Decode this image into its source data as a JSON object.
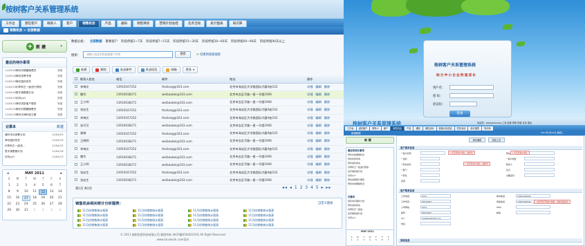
{
  "app": {
    "title": "桉树客户关系管理系统"
  },
  "toplinks": [
    "欢迎您：wangxuesong",
    "工具",
    "设置",
    "帮助",
    "风格",
    "支持",
    "帮助",
    "退出"
  ],
  "nav": {
    "tabs": [
      "工作台",
      "潜在客户",
      "联系人",
      "客户",
      "销售机会",
      "产品",
      "通知",
      "销售目标",
      "营销计划总结",
      "任务活动",
      "统计图表",
      "知识库"
    ]
  },
  "breadcrumb": "销售机会 > 全部数据",
  "datetext": "2011年4月20日 (农历4月初四) 星期三",
  "new_button": {
    "label": "新 建"
  },
  "tasks": {
    "title": "最近的待办事项",
    "items": [
      {
        "date": "11/05/25",
        "text": "拜访刘德耀销售员",
        "status": "完成"
      },
      {
        "date": "11/05/18",
        "text": "拜访张哥专场",
        "status": "完成"
      },
      {
        "date": "11/05/19",
        "text": "拜访蓝科张先",
        "status": "完成"
      },
      {
        "date": "11/04/15",
        "text": "约李科王一起进行预测",
        "status": "完成"
      },
      {
        "date": "11/04/16",
        "text": "签字销售额计划",
        "status": "完成"
      },
      {
        "date": "11/04/13",
        "text": "访问py1",
        "status": "完成"
      },
      {
        "date": "11/04/12",
        "text": "拜访资部客户服务",
        "status": "完成"
      },
      {
        "date": "11/05/10",
        "text": "拜访刘德耀销售员",
        "status": "完成"
      },
      {
        "date": "11/04/15",
        "text": "拜访天津科技王曼",
        "status": "完成"
      }
    ]
  },
  "notes": {
    "title": "记事本",
    "more": "新建",
    "items": [
      {
        "text": "通写本月销售计划",
        "date": "11/04/25"
      },
      {
        "text": "拜访蓝科张先",
        "date": "11/04/19"
      },
      {
        "text": "约李科王一起进...",
        "date": "11/04/15"
      },
      {
        "text": "签字销售额计划",
        "date": "11/04/16"
      },
      {
        "text": "访问py1",
        "date": "11/04/13"
      }
    ]
  },
  "calendar": {
    "month": "MAY 2011",
    "weekdays": [
      "S",
      "M",
      "T",
      "W",
      "T",
      "F",
      "S"
    ],
    "days": [
      "1",
      "2",
      "3",
      "4",
      "5",
      "6",
      "7",
      "8",
      "9",
      "10",
      "11",
      "12",
      "13",
      "14",
      "15",
      "16",
      "17",
      "18",
      "19",
      "20",
      "21",
      "22",
      "23",
      "24",
      "25",
      "26",
      "27",
      "28",
      "29",
      "30",
      "31",
      "1",
      "2",
      "3",
      "4"
    ]
  },
  "filter": {
    "label": "数据分类：",
    "items": [
      "全部数据",
      "重要客户",
      "阶段停留2~7天",
      "阶段停留7~15天",
      "阶段停留15~30天",
      "阶段停留30~60天",
      "阶段停留60~90天",
      "阶段停留90天以上"
    ]
  },
  "search": {
    "label": "搜索：",
    "placeholder": "请输入机会名称或者客户名称",
    "button": "搜索",
    "advanced": "切换到高级搜索"
  },
  "toolbar": [
    "新建",
    "删除",
    "发送邮件",
    "发送短信",
    "邮箱",
    "更多"
  ],
  "table": {
    "headers": [
      "",
      "联系人姓名",
      "电话",
      "邮件",
      "地址",
      "操作"
    ],
    "rows": [
      {
        "name": "李梅文",
        "phone": "13910167252",
        "email": "thailong@163.com",
        "addr": "北京市海淀区大学路国际大厦A座102",
        "ops": [
          "详细",
          "编辑",
          "删除"
        ]
      },
      {
        "name": "魏华",
        "phone": "13910038271",
        "email": "weibaobei@163.com",
        "addr": "北京市台区华路一星一号楼1906",
        "ops": [
          "详细",
          "编辑",
          "删除"
        ]
      },
      {
        "name": "王小明",
        "phone": "13910038271",
        "email": "weibaobei@163.com",
        "addr": "北京市台区华路一星一号楼1906",
        "ops": [
          "详细",
          "编辑",
          "删除"
        ]
      },
      {
        "name": "张宏生",
        "phone": "13910167252",
        "email": "thailong@163.com",
        "addr": "北京市海淀区大学路国际大厦A座102",
        "ops": [
          "详细",
          "编辑",
          "删除"
        ]
      },
      {
        "name": "李梅文",
        "phone": "13910167252",
        "email": "thailong@163.com",
        "addr": "北京市海淀区大学路国际大厦A座102",
        "ops": [
          "详细",
          "编辑",
          "删除"
        ]
      },
      {
        "name": "张可可",
        "phone": "13910038271",
        "email": "weibaobei@163.com",
        "addr": "北京市台区华路一星一号楼1906",
        "ops": [
          "详细",
          "编辑",
          "删除"
        ]
      },
      {
        "name": "谢晓",
        "phone": "13910167252",
        "email": "thailong@163.com",
        "addr": "北京市海淀区大学路国际大厦A座102",
        "ops": [
          "详细",
          "编辑",
          "删除"
        ]
      },
      {
        "name": "王晓明",
        "phone": "13910038271",
        "email": "weibaobei@163.com",
        "addr": "北京市台区华路一星一号楼1906",
        "ops": [
          "详细",
          "编辑",
          "删除"
        ]
      },
      {
        "name": "李梅文",
        "phone": "13910167252",
        "email": "thailong@163.com",
        "addr": "北京市海淀区大学路国际大厦A座102",
        "ops": [
          "详细",
          "编辑",
          "删除"
        ]
      },
      {
        "name": "魏华",
        "phone": "13910038271",
        "email": "weibaobei@163.com",
        "addr": "北京市台区华路一星一号楼1906",
        "ops": [
          "详细",
          "编辑",
          "删除"
        ]
      },
      {
        "name": "王小明",
        "phone": "13910038271",
        "email": "weibaobei@163.com",
        "addr": "北京市台区华路一星一号楼1906",
        "ops": [
          "详细",
          "编辑",
          "删除"
        ]
      },
      {
        "name": "张宏生",
        "phone": "13910167252",
        "email": "thailong@163.com",
        "addr": "北京市海淀区大学路国际大厦A座102",
        "ops": [
          "详细",
          "编辑",
          "删除"
        ]
      },
      {
        "name": "张宏生",
        "phone": "13910038271",
        "email": "weibaobei@163.com",
        "addr": "北京市台区华路一星一号楼1906",
        "ops": [
          "详细",
          "编辑",
          "删除"
        ]
      }
    ]
  },
  "pager": {
    "info": "第1页 共2页",
    "links": "◂◂ ◂ 1 2 3 4 5 ▸ ▸▸"
  },
  "analysis": {
    "title": "销售机会相关统计分析图表：",
    "more": "自定义图表",
    "reports": [
      "11月份销售统计报表",
      "11月份销售统计报表",
      "11月份销售统计报表",
      "11月份销售统计报表",
      "11月份销售统计报表",
      "11月份销售统计报表",
      "11月份销售统计报表",
      "11月份销售统计报表",
      "11月份销售统计报表",
      "11月份销售统计报表",
      "11月份销售统计报表",
      "11月份销售统计报表",
      "11月份销售统计报表",
      "11月份销售统计报表",
      "11月份销售统计报表",
      "11月份销售统计报表"
    ]
  },
  "footer": {
    "line1": "© 2011 桉树信息科技有限公司 版权所有  京ICP备05002010号 All Right Reserved",
    "line2": "www.tanswork.com设计"
  },
  "login": {
    "title": "桉树客户关系管理系统",
    "slogan": "助力中小企业快速成长",
    "fields": [
      "用户名：",
      "密 码：",
      "验证码："
    ],
    "button": "登录"
  },
  "mini": {
    "title": "桉树客户关系管理系统",
    "links": "欢迎您：wangxuesong  工具  设置  帮助  风格  支持  退出",
    "tabs": [
      "工作台",
      "潜在客户",
      "联系人",
      "客户",
      "销售机会",
      "产品",
      "通知",
      "销售目标",
      "营销计划总结",
      "任务活动",
      "统计图表",
      "知识库"
    ],
    "crumb": "新增数据",
    "date": "2011年4月20日 星期三",
    "new": "新 建",
    "tasks_title": "最近的待办事项",
    "tasks": [
      "拜访刘德耀销售员",
      "拜访张哥专场",
      "拜访蓝科张先",
      "约李科王一起进行预测",
      "签字销售额计划",
      "访问py1",
      "拜访资部客户服务",
      "拜访刘德耀销售员"
    ],
    "notes_title": "记事本",
    "notes": [
      "通写本月销售计划",
      "拜访蓝科张先",
      "约李科王一起进",
      "签字销售额计划",
      "访问py1"
    ],
    "cal": "MAY 2011",
    "save": "保存编辑",
    "back": "返回上页",
    "sec1": "客户基本信息",
    "sec2": "客户联系信息",
    "sec3": "其他信息",
    "f": [
      "* 客户名称",
      "* 性别",
      "* 所在省市",
      "* 部门",
      "* 职位",
      "来源",
      "所在地",
      "* 客户类型",
      "联系人",
      "生日",
      "兴趣爱好"
    ],
    "warn1": "! 与已有客户重名，请检查",
    "warn2": "! 与已有客户重名，请检查",
    "warn3": "! 与已有客户重名",
    "c": [
      "工作电话",
      "工作传真",
      "公司网站",
      "邮件",
      "QQ",
      "地址",
      "移动电话",
      "家庭电话",
      "MSN",
      "邮编"
    ],
    "cv": [
      "0731",
      "83234567",
      "0731",
      "83234567",
      "msd5sxe@163.com",
      "13967445945",
      "13967445945"
    ],
    "cw": "! 此号码已有客户使用，请核实后提交"
  }
}
